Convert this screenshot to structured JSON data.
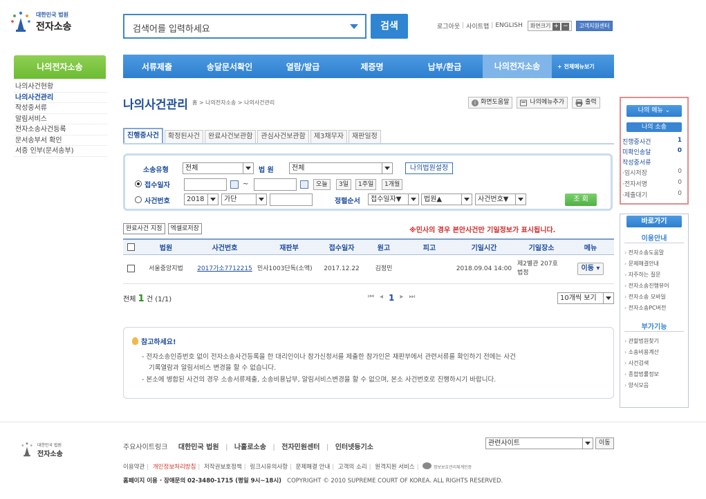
{
  "header": {
    "logo_small": "대한민국 법원",
    "logo_big": "전자소송",
    "search_placeholder": "검색어를 입력하세요",
    "search_button": "검색",
    "util": {
      "logout": "로그아웃",
      "sitemap": "사이트맵",
      "english": "ENGLISH",
      "zoom_label": "화면크기",
      "plus": "+",
      "minus": "−",
      "support": "고객지원센터"
    }
  },
  "gnb": {
    "items": [
      "서류제출",
      "송달문서확인",
      "열람/발급",
      "제증명",
      "납부/환급",
      "나의전자소송"
    ],
    "more": "+ 전체메뉴보기"
  },
  "sidebar": {
    "title": "나의전자소송",
    "items": [
      "나의사건현황",
      "나의사건관리",
      "작성중서류",
      "알림서비스",
      "전자소송사건등록",
      "문서송부서 확인",
      "서증 인부(문서송부)"
    ]
  },
  "page": {
    "title": "나의사건관리",
    "breadcrumb": "홈 > 나의전자소송 > 나의사건관리",
    "tools": {
      "help": "화면도움말",
      "add_menu": "나의메뉴추가",
      "print": "출력"
    }
  },
  "tabs": [
    "진행중사건",
    "확정된사건",
    "완료사건보관함",
    "관심사건보관함",
    "제3채무자",
    "재판일정"
  ],
  "filter": {
    "case_type_label": "소송유형",
    "case_type_value": "전체",
    "court_label": "법 원",
    "court_value": "전체",
    "court_setting": "나의법원설정",
    "receipt_date_label": "접수일자",
    "tilde": "~",
    "quick_ranges": [
      "오늘",
      "3일",
      "1주일",
      "1개월"
    ],
    "case_no_label": "사건번호",
    "year_value": "2018",
    "kind_value": "가단",
    "sort_label": "정렬순서",
    "sort1": "접수일자▼",
    "sort2": "법원▲",
    "sort3": "사건번호▼",
    "query_button": "조 회"
  },
  "table_tools": {
    "completed": "완료사건 지정",
    "excel": "엑셀로저장"
  },
  "notice_red": "※민사의 경우 본안사건만 기일정보가 표시됩니다.",
  "table": {
    "headers": [
      "법원",
      "사건번호",
      "재판부",
      "접수일자",
      "원고",
      "피고",
      "기일시간",
      "기일장소",
      "메뉴"
    ],
    "rows": [
      {
        "court": "서울중앙지법",
        "case_no": "2017가소7712215",
        "division": "민사1003단독(소액)",
        "date": "2017.12.22",
        "plaintiff": "김정민",
        "defendant": "",
        "hearing_time": "2018.09.04 14:00",
        "hearing_place": "제2별관 207호 법정",
        "menu": "이동"
      }
    ]
  },
  "summary": {
    "prefix": "전체",
    "count": "1",
    "suffix": "건 (1/1)",
    "page_current": "1",
    "per_page": "10개씩 보기"
  },
  "info": {
    "title": "참고하세요!",
    "lines": [
      "- 전자소송인증번호 없이 전자소송사건등록을 한 대리인이나 참가신청서를 제출한 참가인은 재판부에서 관련서류를 확인하기 전에는 사건",
      "기록열람과 알림서비스 변경을 할 수 없습니다.",
      "- 본소에 병합된 사건의 경우 소송서류제출, 소송비용납부, 알림서비스변경을 할 수 없으며, 본소 사건번호로 진행하시기 바랍니다."
    ]
  },
  "right_panel": {
    "my_menu": "나의 메뉴 ⌄",
    "my_lawsuit": "나의 소송",
    "rows": [
      {
        "label": "진행중사건",
        "value": "1"
      },
      {
        "label": "미확인송달",
        "value": "0"
      },
      {
        "label": "작성중서류",
        "value": ""
      },
      {
        "label": "·임시저장",
        "value": "0"
      },
      {
        "label": "·전자서명",
        "value": "0"
      },
      {
        "label": "·제출대기",
        "value": "0"
      }
    ],
    "quick_title": "바로가기",
    "guide_title": "이용안내",
    "guide_links": [
      "전자소송도움말",
      "문제해결안내",
      "자주하는 질문",
      "전자소송진행뷰어",
      "전자소송 모바일",
      "전자소송PC버전"
    ],
    "extra_title": "부가기능",
    "extra_links": [
      "관할법원찾기",
      "소송비용계산",
      "사건검색",
      "종합법률정보",
      "양식모음"
    ]
  },
  "footer": {
    "logo_small": "대한민국 법원",
    "logo_big": "전자소송",
    "links_label": "주요사이트링크",
    "links": [
      "대한민국 법원",
      "나홀로소송",
      "전자민원센터",
      "인터넷등기소"
    ],
    "related": "관련사이트",
    "go": "이동",
    "policy_links": [
      "이용약관",
      "개인정보처리방침",
      "저작권보호정책",
      "링크시유의사항",
      "문제해결 안내",
      "고객의 소리",
      "원격지원 서비스"
    ],
    "award": "정보보호관리체계인증",
    "contact_label": "홈페이지 이용 · 장애문의",
    "contact_phone": "02-3480-1715 (평일 9시~18시)",
    "copyright": "COPYRIGHT © 2010 SUPREME COURT OF KOREA. ALL RIGHTS RESERVED."
  }
}
